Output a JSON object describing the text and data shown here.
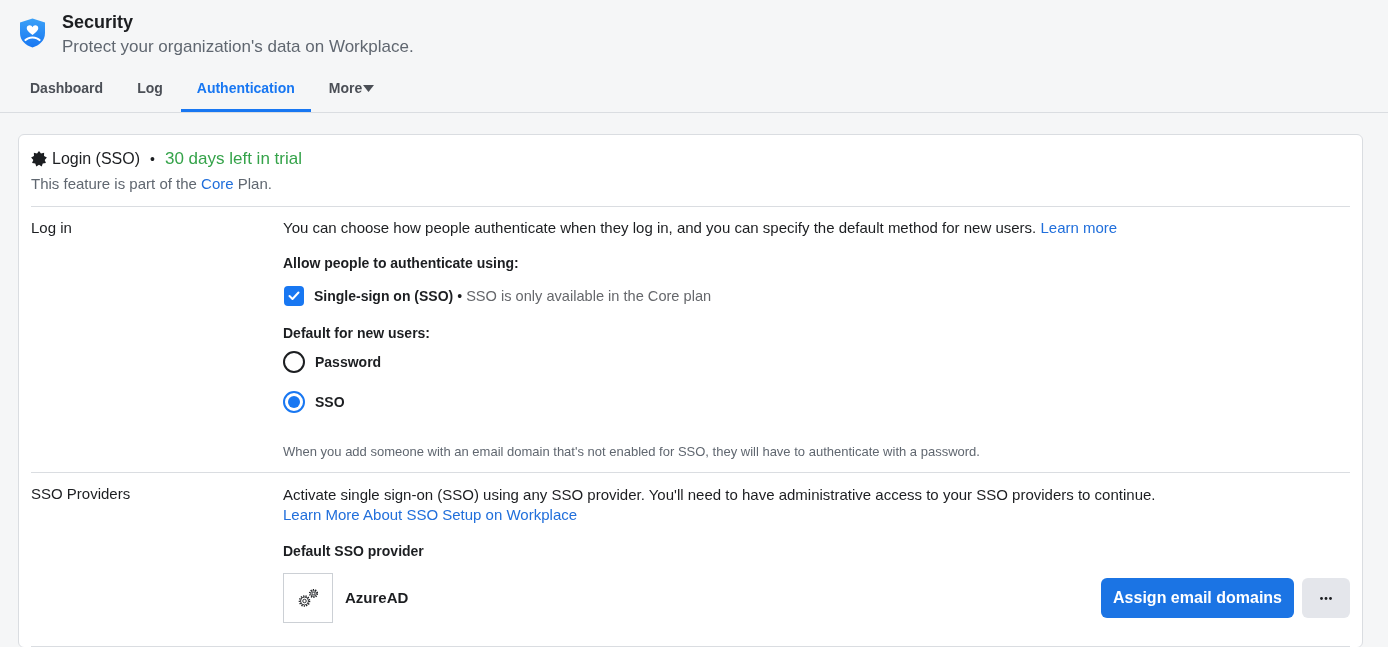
{
  "header": {
    "title": "Security",
    "subtitle": "Protect your organization's data on Workplace."
  },
  "tabs": [
    {
      "label": "Dashboard",
      "kind": "tab",
      "selected": false
    },
    {
      "label": "Log",
      "kind": "tab",
      "selected": false
    },
    {
      "label": "Authentication",
      "kind": "tab",
      "selected": true
    },
    {
      "label": "More",
      "kind": "menu",
      "selected": false
    }
  ],
  "feature": {
    "title": "Login (SSO)",
    "separator": "•",
    "trial": "30 days left in trial",
    "plan_note": {
      "before": "This feature is part of the ",
      "link": "Core",
      "after": " Plan."
    }
  },
  "login_section": {
    "label": "Log in",
    "intro": {
      "text": "You can choose how people authenticate when they log in, and you can specify the default method for new users. ",
      "link": "Learn more"
    },
    "allow_heading": "Allow people to authenticate using:",
    "methods": [
      {
        "label": "Single-sign on (SSO)",
        "separator": "•",
        "note": "SSO is only available in the Core plan",
        "checked": true
      }
    ],
    "default_heading": "Default for new users:",
    "default_options": [
      {
        "label": "Password",
        "selected": false
      },
      {
        "label": "SSO",
        "selected": true
      }
    ],
    "footnote": "When you add someone with an email domain that's not enabled for SSO, they will have to authenticate with a password."
  },
  "providers_section": {
    "label": "SSO Providers",
    "intro": {
      "text": "Activate single sign-on (SSO) using any SSO provider. You'll need to have administrative access to your SSO providers to continue. ",
      "link": "Learn More About SSO Setup on Workplace"
    },
    "default_heading": "Default SSO provider",
    "providers": [
      {
        "name": "AzureAD",
        "action": "Assign email domains"
      }
    ]
  }
}
